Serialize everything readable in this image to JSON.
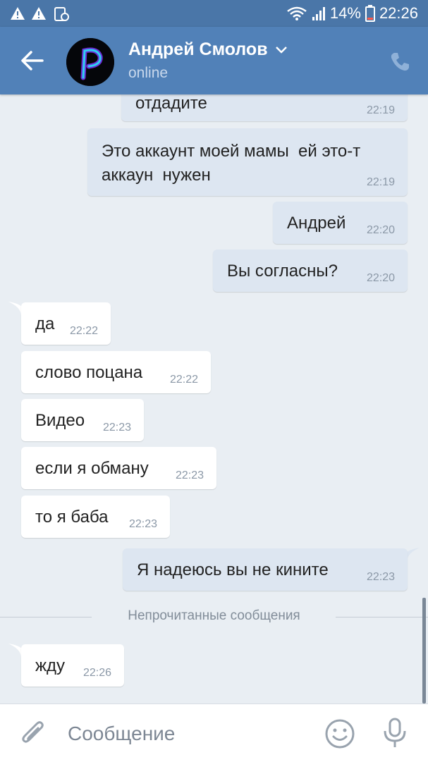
{
  "status_bar": {
    "battery_percent": "14%",
    "time": "22:26"
  },
  "header": {
    "name": "Андрей Смолов",
    "status": "online"
  },
  "messages": [
    {
      "dir": "out",
      "text": "отдадите",
      "time": "22:19"
    },
    {
      "dir": "out",
      "text": "Это аккаунт моей мамы  ей это-т\nаккаун  нужен",
      "time": "22:19"
    },
    {
      "dir": "out",
      "text": "Андрей",
      "time": "22:20"
    },
    {
      "dir": "out",
      "text": "Вы согласны?",
      "time": "22:20"
    },
    {
      "dir": "in",
      "text": "да",
      "time": "22:22"
    },
    {
      "dir": "in",
      "text": "слово поцана",
      "time": "22:22"
    },
    {
      "dir": "in",
      "text": "Видео",
      "time": "22:23"
    },
    {
      "dir": "in",
      "text": "если я обману",
      "time": "22:23"
    },
    {
      "dir": "in",
      "text": "то я баба",
      "time": "22:23"
    },
    {
      "dir": "out",
      "text": "Я надеюсь вы не кините",
      "time": "22:23"
    },
    {
      "dir": "in",
      "text": "жду",
      "time": "22:26"
    }
  ],
  "unread_divider": "Непрочитанные сообщения",
  "composer": {
    "placeholder": "Сообщение"
  },
  "colors": {
    "header": "#5181b8",
    "status_bar": "#4a76a8",
    "outgoing_bubble": "#dde6f1",
    "incoming_bubble": "#ffffff",
    "background": "#e9eef3"
  }
}
